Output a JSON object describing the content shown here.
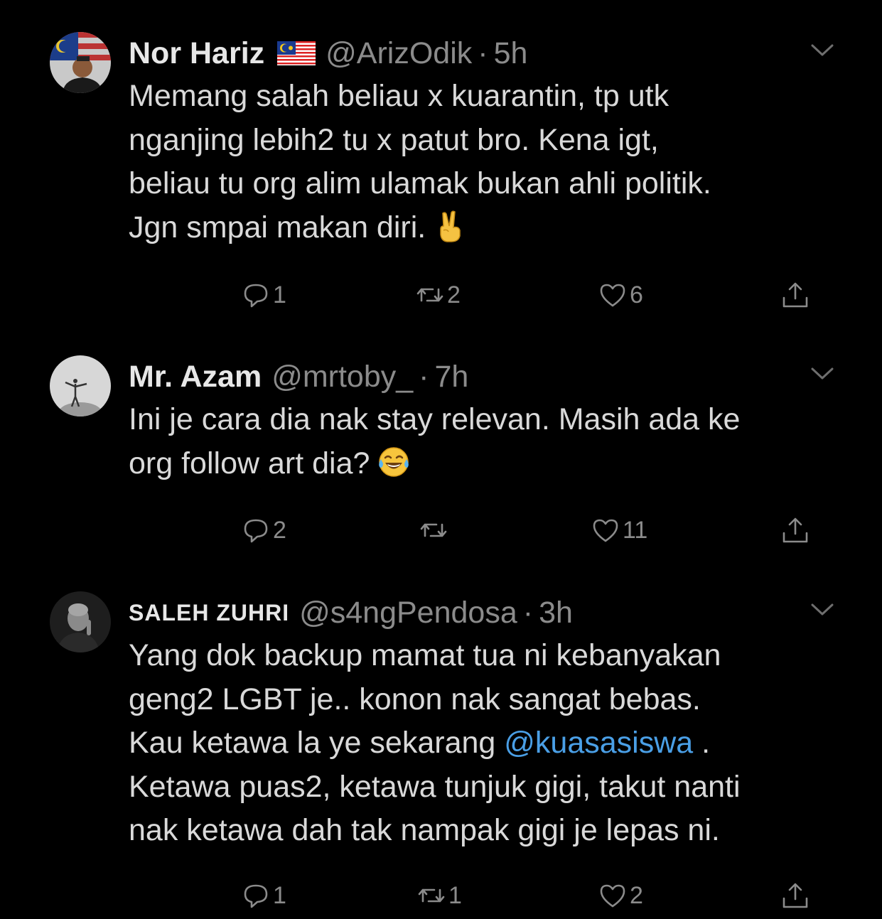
{
  "tweets": [
    {
      "name": "Nor Hariz",
      "flag": "malaysia-flag",
      "handle": "@ArizOdik",
      "separator": "·",
      "time": "5h",
      "lines": [
        "Memang salah beliau x kuarantin, tp utk",
        "nganjing lebih2 tu x patut bro. Kena igt,",
        "beliau tu org alim ulamak bukan ahli politik.",
        "Jgn smpai makan diri."
      ],
      "emoji": "victory-hand-emoji",
      "replies": "1",
      "retweets": "2",
      "likes": "6"
    },
    {
      "name": "Mr. Azam",
      "handle": "@mrtoby_",
      "separator": "·",
      "time": "7h",
      "lines": [
        "Ini je cara dia nak stay relevan. Masih ada ke",
        "org follow art dia?"
      ],
      "emoji": "tears-of-joy-emoji",
      "replies": "2",
      "retweets": "",
      "likes": "11"
    },
    {
      "name": "SALEH ZUHRI",
      "handle": "@s4ngPendosa",
      "separator": "·",
      "time": "3h",
      "lines": [
        "Yang dok backup mamat tua ni kebanyakan",
        "geng2 LGBT je.. konon nak sangat bebas.",
        "Kau ketawa la ye sekarang ",
        "Ketawa puas2, ketawa tunjuk gigi, takut nanti",
        "nak ketawa dah tak nampak gigi je lepas ni."
      ],
      "mention": "@kuasasiswa",
      "mention_suffix": " .",
      "replies": "1",
      "retweets": "1",
      "likes": "2"
    }
  ],
  "colors": {
    "background": "#000000",
    "text": "#d9d9d9",
    "secondary": "#8b8b8b",
    "mention": "#4a9fe6"
  }
}
